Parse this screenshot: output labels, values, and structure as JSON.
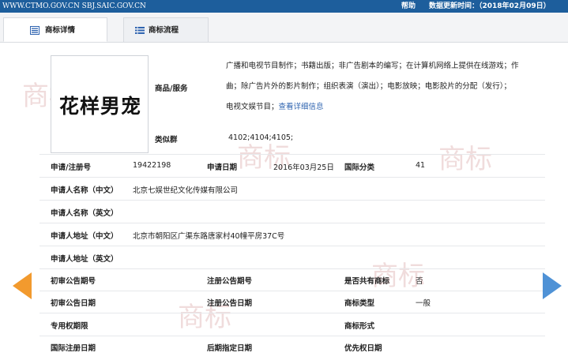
{
  "topbar": {
    "url_text": "WWW.CTMO.GOV.CN SBJ.SAIC.GOV.CN",
    "help": "帮助",
    "update": "数据更新时间：（2018年02月09日）"
  },
  "tabs": [
    {
      "label": "商标详情",
      "icon": "detail-list-icon"
    },
    {
      "label": "商标流程",
      "icon": "flow-list-icon"
    }
  ],
  "trademark": {
    "mark_text": "花样男宠",
    "goods_label": "商品/服务",
    "goods_lines": [
      "广播和电视节目制作；书籍出版；非广告剧本的编写；在计算机网络上提供在线游戏；作",
      "曲；除广告片外的影片制作；组织表演（演出）；电影放映；电影胶片的分配（发行）；"
    ],
    "goods_last": "电视文娱节目；",
    "goods_link": "查看详细信息",
    "similar_label": "类似群",
    "similar_value": "4102;4104;4105;"
  },
  "fields": {
    "reg_no_label": "申请/注册号",
    "reg_no": "19422198",
    "app_date_label": "申请日期",
    "app_date": "2016年03月25日",
    "intl_class_label": "国际分类",
    "intl_class": "41",
    "applicant_cn_label": "申请人名称（中文）",
    "applicant_cn": "北京七娱世纪文化传媒有限公司",
    "applicant_en_label": "申请人名称（英文）",
    "applicant_en": "",
    "address_cn_label": "申请人地址（中文）",
    "address_cn": "北京市朝阳区广渠东路唐家村40幢平房37C号",
    "address_en_label": "申请人地址（英文）",
    "address_en": "",
    "prelim_no_label": "初审公告期号",
    "reg_pub_no_label": "注册公告期号",
    "shared_label": "是否共有商标",
    "shared_value": "否",
    "prelim_date_label": "初审公告日期",
    "reg_pub_date_label": "注册公告日期",
    "tm_type_label": "商标类型",
    "tm_type_value": "一般",
    "exclusive_label": "专用权期限",
    "tm_form_label": "商标形式",
    "intl_reg_date_label": "国际注册日期",
    "later_date_label": "后期指定日期",
    "priority_date_label": "优先权日期"
  },
  "watermark": "商标",
  "colors": {
    "topbar": "#1d5e9c",
    "link": "#2f64b0",
    "prev_arrow": "#f29a2e",
    "next_arrow": "#4f92d6"
  }
}
